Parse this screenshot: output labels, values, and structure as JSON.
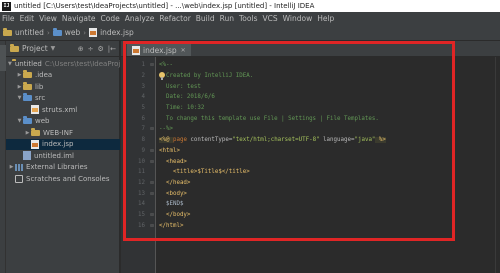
{
  "window": {
    "title": "untitled [C:\\Users\\test\\IdeaProjects\\untitled] - ...\\web\\index.jsp [untitled] - IntelliJ IDEA",
    "icon": "intellij-icon"
  },
  "menu": [
    "File",
    "Edit",
    "View",
    "Navigate",
    "Code",
    "Analyze",
    "Refactor",
    "Build",
    "Run",
    "Tools",
    "VCS",
    "Window",
    "Help"
  ],
  "breadcrumb": {
    "project": "untitled",
    "folder": "web",
    "file": "index.jsp"
  },
  "project_panel": {
    "title": "Project",
    "tools": [
      "⊕",
      "÷",
      "⚙",
      "|←"
    ]
  },
  "tree": {
    "root": "untitled",
    "root_path": "C:\\Users\\test\\IdeaProjects\\untitled",
    "idea": ".idea",
    "lib": "lib",
    "src": "src",
    "struts": "struts.xml",
    "web": "web",
    "webinf": "WEB-INF",
    "index": "index.jsp",
    "iml": "untitled.iml",
    "ext": "External Libraries",
    "scratch": "Scratches and Consoles"
  },
  "editor": {
    "tab_label": "index.jsp",
    "lines": [
      {
        "n": "1",
        "fold": "⊟",
        "text": "<%--"
      },
      {
        "n": "2",
        "fold": "",
        "text": "  Created by IntelliJ IDEA."
      },
      {
        "n": "3",
        "fold": "",
        "text": "  User: test"
      },
      {
        "n": "4",
        "fold": "",
        "text": "  Date: 2018/6/6"
      },
      {
        "n": "5",
        "fold": "",
        "text": "  Time: 10:32"
      },
      {
        "n": "6",
        "fold": "",
        "text": "  To change this template use File | Settings | File Templates."
      },
      {
        "n": "7",
        "fold": "⊟",
        "text": "--%>"
      },
      {
        "n": "8",
        "fold": "",
        "directive_open": "<%@ ",
        "page_kw": "page",
        "attr1": " contentType=",
        "val1": "\"text/html;charset=UTF-8\"",
        "attr2": " language=",
        "val2": "\"java\"",
        "directive_close": " %>"
      },
      {
        "n": "9",
        "fold": "⊟",
        "text": "<html>"
      },
      {
        "n": "10",
        "fold": "⊟",
        "text": "  <head>"
      },
      {
        "n": "11",
        "fold": "",
        "text": "    <title>$Title$</title>"
      },
      {
        "n": "12",
        "fold": "⊟",
        "text": "  </head>"
      },
      {
        "n": "13",
        "fold": "⊟",
        "text": "  <body>"
      },
      {
        "n": "14",
        "fold": "",
        "text": "  $END$"
      },
      {
        "n": "15",
        "fold": "⊟",
        "text": "  </body>"
      },
      {
        "n": "16",
        "fold": "⊟",
        "text": "</html>"
      }
    ]
  },
  "colors": {
    "highlight_box": "#e02525",
    "tab_accent": "#4a88c7"
  }
}
